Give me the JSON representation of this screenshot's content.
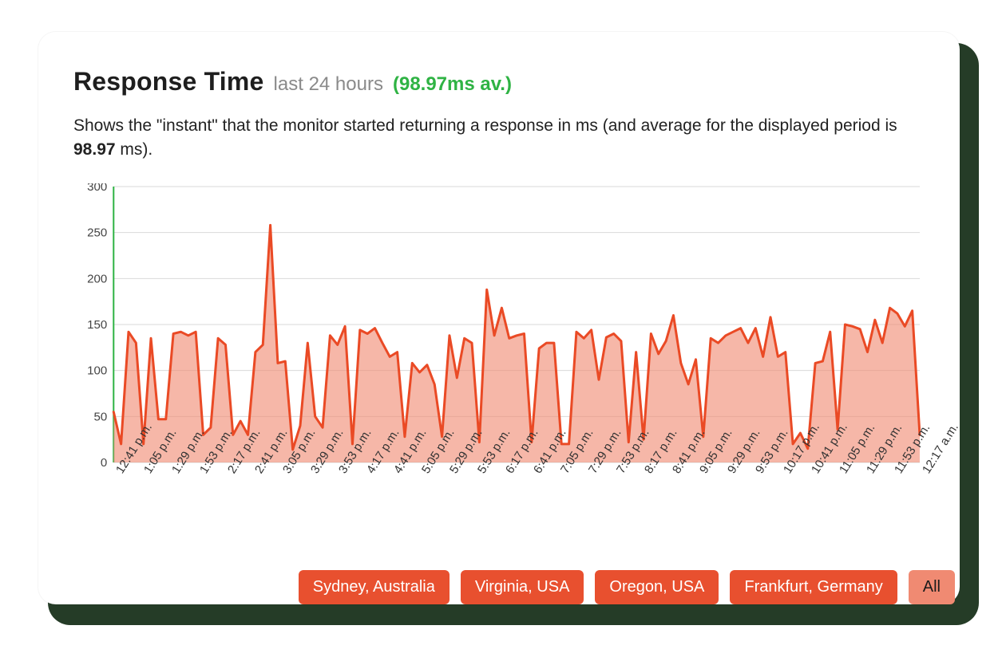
{
  "header": {
    "title": "Response Time",
    "subtitle1": "last 24 hours",
    "subtitle2_prefix": "(",
    "subtitle2_value": "98.97ms av.",
    "subtitle2_suffix": ")"
  },
  "description": {
    "text_before": "Shows the \"instant\" that the monitor started returning a response in ms (and average for the displayed period is ",
    "bold_value": "98.97",
    "text_after": " ms)."
  },
  "legend": {
    "items": [
      "Sydney, Australia",
      "Virginia, USA",
      "Oregon, USA",
      "Frankfurt, Germany"
    ],
    "all": "All"
  },
  "chart_data": {
    "type": "area",
    "title": "Response Time last 24 hours",
    "xlabel": "",
    "ylabel": "",
    "ylim": [
      0,
      300
    ],
    "y_ticks": [
      0,
      50,
      100,
      150,
      200,
      250,
      300
    ],
    "categories": [
      "12:41 p.m.",
      "1:05 p.m.",
      "1:29 p.m.",
      "1:53 p.m.",
      "2:17 p.m.",
      "2:41 p.m.",
      "3:05 p.m.",
      "3:29 p.m.",
      "3:53 p.m.",
      "4:17 p.m.",
      "4:41 p.m.",
      "5:05 p.m.",
      "5:29 p.m.",
      "5:53 p.m.",
      "6:17 p.m.",
      "6:41 p.m.",
      "7:05 p.m.",
      "7:29 p.m.",
      "7:53 p.m.",
      "8:17 p.m.",
      "8:41 p.m.",
      "9:05 p.m.",
      "9:29 p.m.",
      "9:53 p.m.",
      "10:17 p.m.",
      "10:41 p.m.",
      "11:05 p.m.",
      "11:29 p.m.",
      "11:53 p.m.",
      "12:17 a.m."
    ],
    "values": [
      55,
      20,
      142,
      130,
      20,
      135,
      47,
      47,
      140,
      142,
      138,
      142,
      30,
      38,
      135,
      128,
      30,
      45,
      30,
      120,
      128,
      258,
      108,
      110,
      14,
      40,
      130,
      50,
      38,
      138,
      128,
      148,
      20,
      144,
      140,
      146,
      130,
      115,
      120,
      28,
      108,
      98,
      106,
      85,
      28,
      138,
      92,
      135,
      130,
      22,
      188,
      138,
      168,
      135,
      138,
      140,
      22,
      124,
      130,
      130,
      20,
      20,
      142,
      135,
      144,
      90,
      136,
      140,
      132,
      22,
      120,
      25,
      140,
      118,
      132,
      160,
      108,
      85,
      112,
      28,
      135,
      130,
      138,
      142,
      146,
      130,
      146,
      115,
      158,
      115,
      120,
      20,
      32,
      15,
      108,
      110,
      142,
      36,
      150,
      148,
      145,
      120,
      155,
      130,
      168,
      162,
      148,
      165,
      30
    ],
    "colors": {
      "stroke": "#ea4a25",
      "fill": "#f08a72",
      "axis": "#2fb344"
    }
  }
}
